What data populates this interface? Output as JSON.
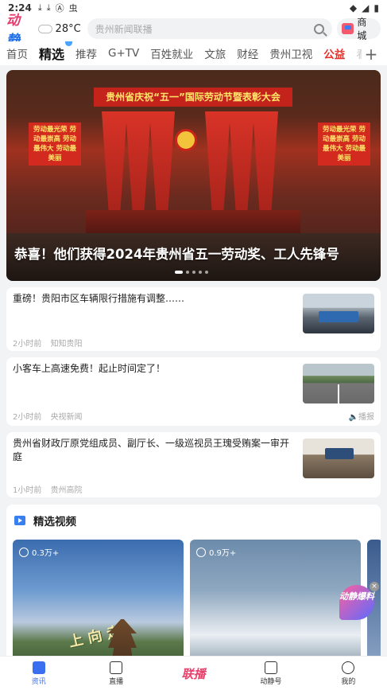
{
  "status_bar": {
    "time": "2:24",
    "icons": [
      "download-icon",
      "download-icon",
      "a-icon",
      "bug-icon"
    ],
    "right_icons": [
      "wifi-icon",
      "signal-icon",
      "battery-icon"
    ]
  },
  "header": {
    "logo_a": "动",
    "logo_b": "静",
    "temperature": "28°C",
    "search_placeholder": "贵州新闻联播",
    "mall_label": "商城"
  },
  "tabs": [
    {
      "label": "首页"
    },
    {
      "label": "精选"
    },
    {
      "label": "推荐"
    },
    {
      "label": "G+TV"
    },
    {
      "label": "百姓就业"
    },
    {
      "label": "文旅"
    },
    {
      "label": "财经"
    },
    {
      "label": "贵州卫视"
    },
    {
      "label": "公益"
    },
    {
      "label": "看"
    }
  ],
  "hero": {
    "caption": "恭喜！他们获得2024年贵州省五一劳动奖、工人先锋号",
    "banner_text": "贵州省庆祝“五一”国际劳动节暨表彰大会",
    "left_board": "劳动最光荣 劳动最崇高 劳动最伟大 劳动最美丽",
    "right_board": "劳动最光荣 劳动最崇高 劳动最伟大 劳动最美丽"
  },
  "news": [
    {
      "title": "重磅！贵阳市区车辆限行措施有调整……",
      "time": "2小时前",
      "source": "知知贵阳"
    },
    {
      "title": "小客车上高速免费！起止时间定了！",
      "time": "2小时前",
      "source": "央视新闻",
      "report": "播报"
    },
    {
      "title": "贵州省财政厅原党组成员、副厅长、一级巡视员王瑰受贿案一审开庭",
      "time": "1小时前",
      "source": "贵州高院"
    }
  ],
  "video_section": {
    "title": "精选视频",
    "videos": [
      {
        "views": "0.3万+"
      },
      {
        "views": "0.9万+"
      }
    ],
    "calligraphy": "上 向 走"
  },
  "float_badge": {
    "text": "动静爆料",
    "close": "×"
  },
  "bottom_nav": [
    {
      "label": "资讯"
    },
    {
      "label": "直播"
    },
    {
      "label": "联播"
    },
    {
      "label": "动静号"
    },
    {
      "label": "我的"
    }
  ],
  "colors": {
    "accent": "#3a6ff0",
    "brand_pink": "#e8406b",
    "red": "#e8302a"
  }
}
